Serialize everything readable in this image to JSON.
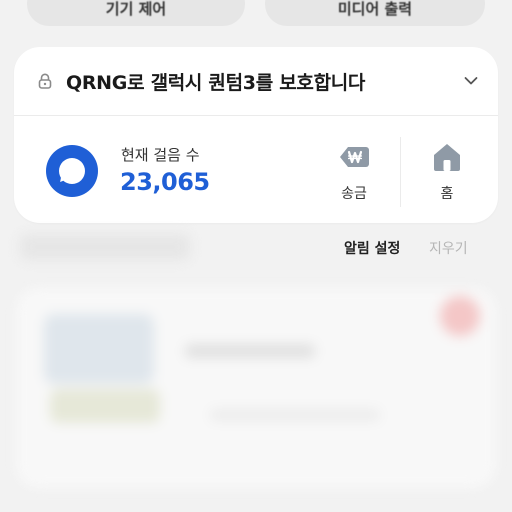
{
  "top_buttons": {
    "left_label": "기기 제어",
    "right_label": "미디어 출력"
  },
  "card": {
    "title": "QRNG로 갤럭시 퀀텀3를 보호합니다",
    "steps_label": "현재 걸음 수",
    "steps_value": "23,065",
    "actions": [
      {
        "label": "송금",
        "icon": "won-send-icon"
      },
      {
        "label": "홈",
        "icon": "home-icon"
      }
    ]
  },
  "notifications": {
    "settings_label": "알림 설정",
    "clear_label": "지우기"
  },
  "colors": {
    "accent": "#1f5fd6",
    "icon_gray": "#8f9aa6"
  }
}
